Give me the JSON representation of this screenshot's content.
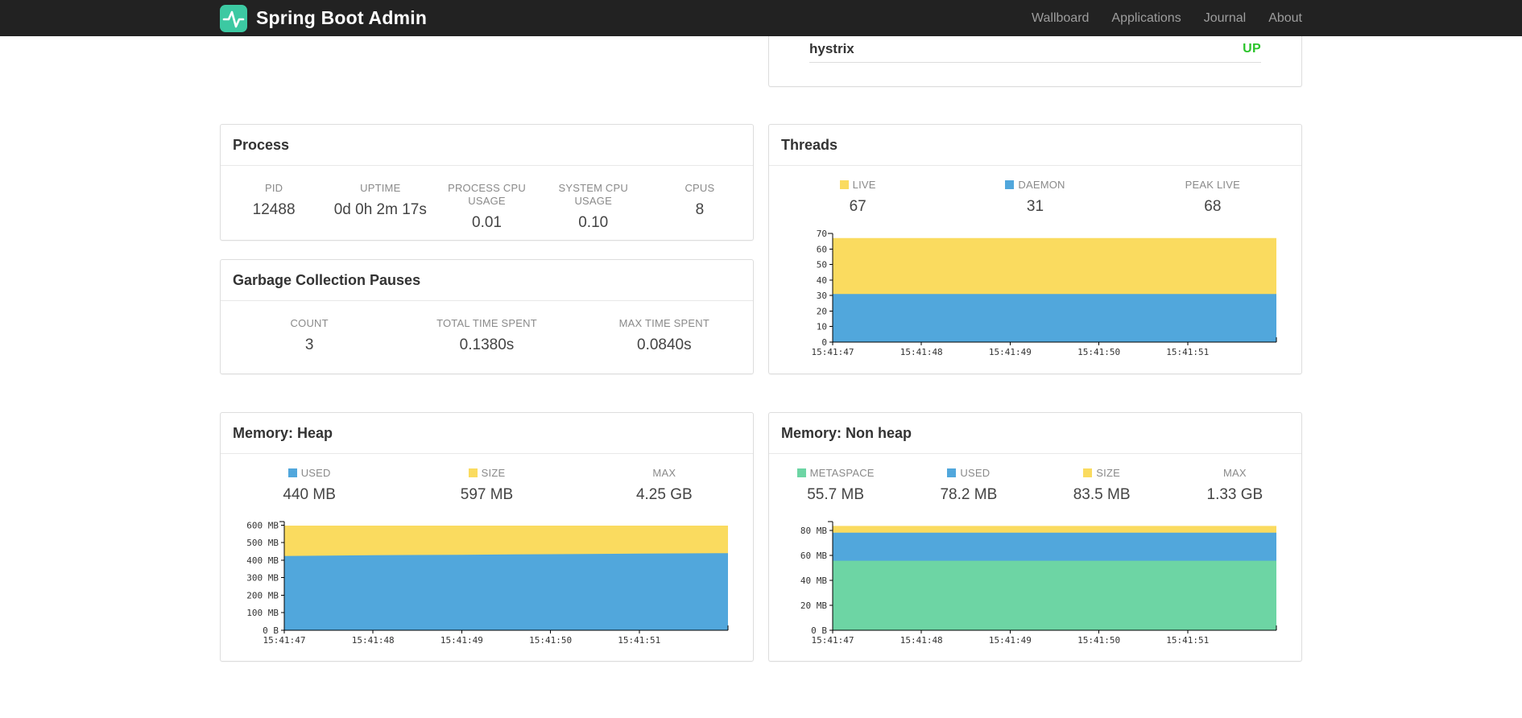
{
  "navbar": {
    "brand": "Spring Boot Admin",
    "links": [
      {
        "label": "Wallboard"
      },
      {
        "label": "Applications"
      },
      {
        "label": "Journal"
      },
      {
        "label": "About"
      }
    ]
  },
  "colors": {
    "logo": "#3cc9a2",
    "up": "#2bc42b",
    "blue": "#51a7dc",
    "yellow": "#fadb5f",
    "green": "#6dd5a4"
  },
  "health": {
    "item": "hystrix",
    "status": "UP"
  },
  "process": {
    "title": "Process",
    "stats": [
      {
        "label": "PID",
        "value": "12488"
      },
      {
        "label": "UPTIME",
        "value": "0d 0h 2m 17s"
      },
      {
        "label": "PROCESS CPU USAGE",
        "value": "0.01"
      },
      {
        "label": "SYSTEM CPU USAGE",
        "value": "0.10"
      },
      {
        "label": "CPUS",
        "value": "8"
      }
    ]
  },
  "gc": {
    "title": "Garbage Collection Pauses",
    "stats": [
      {
        "label": "COUNT",
        "value": "3"
      },
      {
        "label": "TOTAL TIME SPENT",
        "value": "0.1380s"
      },
      {
        "label": "MAX TIME SPENT",
        "value": "0.0840s"
      }
    ]
  },
  "threads": {
    "title": "Threads",
    "stats": [
      {
        "label": "LIVE",
        "value": "67",
        "swatch": "#fadb5f"
      },
      {
        "label": "DAEMON",
        "value": "31",
        "swatch": "#51a7dc"
      },
      {
        "label": "PEAK LIVE",
        "value": "68"
      }
    ]
  },
  "heap": {
    "title": "Memory: Heap",
    "stats": [
      {
        "label": "USED",
        "value": "440 MB",
        "swatch": "#51a7dc"
      },
      {
        "label": "SIZE",
        "value": "597 MB",
        "swatch": "#fadb5f"
      },
      {
        "label": "MAX",
        "value": "4.25 GB"
      }
    ]
  },
  "nonheap": {
    "title": "Memory: Non heap",
    "stats": [
      {
        "label": "METASPACE",
        "value": "55.7 MB",
        "swatch": "#6dd5a4"
      },
      {
        "label": "USED",
        "value": "78.2 MB",
        "swatch": "#51a7dc"
      },
      {
        "label": "SIZE",
        "value": "83.5 MB",
        "swatch": "#fadb5f"
      },
      {
        "label": "MAX",
        "value": "1.33 GB"
      }
    ]
  },
  "chart_data": [
    {
      "name": "threads",
      "type": "area",
      "legend_position": "top",
      "grid": false,
      "x_ticks": [
        "15:41:47",
        "15:41:48",
        "15:41:49",
        "15:41:50",
        "15:41:51"
      ],
      "ylim": [
        0,
        70
      ],
      "yticks": [
        {
          "v": 0,
          "label": "0"
        },
        {
          "v": 10,
          "label": "10"
        },
        {
          "v": 20,
          "label": "20"
        },
        {
          "v": 30,
          "label": "30"
        },
        {
          "v": 40,
          "label": "40"
        },
        {
          "v": 50,
          "label": "50"
        },
        {
          "v": 60,
          "label": "60"
        },
        {
          "v": 70,
          "label": "70"
        }
      ],
      "series": [
        {
          "name": "LIVE",
          "color": "#fadb5f",
          "values": [
            67,
            67,
            67,
            67,
            67,
            67
          ]
        },
        {
          "name": "DAEMON",
          "color": "#51a7dc",
          "values": [
            31,
            31,
            31,
            31,
            31,
            31
          ]
        }
      ]
    },
    {
      "name": "memory-heap",
      "type": "area",
      "legend_position": "top",
      "grid": false,
      "x_ticks": [
        "15:41:47",
        "15:41:48",
        "15:41:49",
        "15:41:50",
        "15:41:51"
      ],
      "ylim": [
        0,
        620
      ],
      "yticks": [
        {
          "v": 0,
          "label": "0 B"
        },
        {
          "v": 100,
          "label": "100 MB"
        },
        {
          "v": 200,
          "label": "200 MB"
        },
        {
          "v": 300,
          "label": "300 MB"
        },
        {
          "v": 400,
          "label": "400 MB"
        },
        {
          "v": 500,
          "label": "500 MB"
        },
        {
          "v": 600,
          "label": "600 MB"
        }
      ],
      "series": [
        {
          "name": "SIZE",
          "color": "#fadb5f",
          "values": [
            597,
            597,
            597,
            597,
            597,
            597
          ]
        },
        {
          "name": "USED",
          "color": "#51a7dc",
          "values": [
            424,
            428,
            431,
            434,
            437,
            440
          ]
        }
      ]
    },
    {
      "name": "memory-nonheap",
      "type": "area",
      "legend_position": "top",
      "grid": false,
      "x_ticks": [
        "15:41:47",
        "15:41:48",
        "15:41:49",
        "15:41:50",
        "15:41:51"
      ],
      "ylim": [
        0,
        87
      ],
      "yticks": [
        {
          "v": 0,
          "label": "0 B"
        },
        {
          "v": 20,
          "label": "20 MB"
        },
        {
          "v": 40,
          "label": "40 MB"
        },
        {
          "v": 60,
          "label": "60 MB"
        },
        {
          "v": 80,
          "label": "80 MB"
        }
      ],
      "series": [
        {
          "name": "SIZE",
          "color": "#fadb5f",
          "values": [
            83.5,
            83.5,
            83.5,
            83.5,
            83.5,
            83.5
          ]
        },
        {
          "name": "USED",
          "color": "#51a7dc",
          "values": [
            78.2,
            78.2,
            78.2,
            78.2,
            78.2,
            78.2
          ]
        },
        {
          "name": "METASPACE",
          "color": "#6dd5a4",
          "values": [
            55.7,
            55.7,
            55.7,
            55.7,
            55.7,
            55.7
          ]
        }
      ]
    }
  ]
}
